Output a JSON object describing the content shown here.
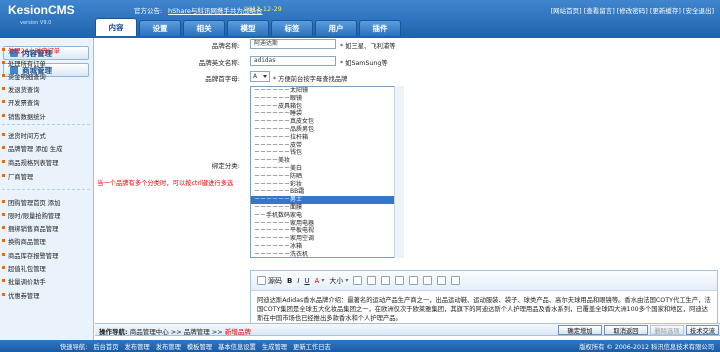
{
  "app": {
    "name": "KesionCMS",
    "version": "version V9.0"
  },
  "announce": {
    "label": "官方公告:",
    "item1": "hShare与科讯网携手共为战略合",
    "item2": "2011-12-29"
  },
  "toplinks": [
    "[网站首页]",
    "[查看留言]",
    "[修改密码]",
    "[更新缓存]",
    "[安全退出]"
  ],
  "tabs": [
    "内容",
    "设置",
    "相关",
    "模型",
    "标签",
    "用户",
    "插件"
  ],
  "sidebar": {
    "btn_content": "内容管理",
    "btn_mall": "商城管理",
    "items": [
      {
        "label": "处理24小时内订单",
        "red": true
      },
      {
        "label": "处理所有订单",
        "red": false
      },
      {
        "label": "资金明细查询",
        "red": false
      },
      {
        "label": "发退货查询",
        "red": false
      },
      {
        "label": "开发票查询",
        "red": false
      },
      {
        "label": "销售数据统计",
        "red": false
      },
      {
        "label": "送货时间方式",
        "red": false
      },
      {
        "label": "品牌管理 添加 生成",
        "red": false
      },
      {
        "label": "商品规格列表管理",
        "red": false
      },
      {
        "label": "厂商管理",
        "red": false
      },
      {
        "label": "团购管理首页 添加",
        "red": false
      },
      {
        "label": "限时/限量抢购管理",
        "red": false
      },
      {
        "label": "捆绑销售商品管理",
        "red": false
      },
      {
        "label": "换购商品管理",
        "red": false
      },
      {
        "label": "商品库存报警管理",
        "red": false
      },
      {
        "label": "超值礼包管理",
        "red": false
      },
      {
        "label": "批量调价助手",
        "red": false
      },
      {
        "label": "优惠券管理",
        "red": false
      }
    ]
  },
  "form": {
    "brand_name_label": "品牌名称:",
    "brand_name_value": "阿迪达斯",
    "brand_name_hint": "* 如三星、飞利浦等",
    "brand_en_label": "品牌英文名称:",
    "brand_en_value": "adidas",
    "brand_en_hint": "* 如SamSung等",
    "letter_label": "品牌首字母:",
    "letter_value": "A",
    "letter_hint": "* 方便前台按字母查找品牌",
    "category_label": "绑定分类:",
    "category_tip": "当一个品牌有多个分类时，可以按ctrl键进行多选",
    "categories": [
      {
        "text": "－－－－－－太阳镜",
        "selected": false
      },
      {
        "text": "－－－－－－眼镜",
        "selected": false
      },
      {
        "text": "－－－－皮具箱包",
        "selected": false
      },
      {
        "text": "－－－－－－睡袋",
        "selected": false
      },
      {
        "text": "－－－－－－真皮女包",
        "selected": false
      },
      {
        "text": "－－－－－－品质男包",
        "selected": false
      },
      {
        "text": "－－－－－－拉杆箱",
        "selected": false
      },
      {
        "text": "－－－－－－皮带",
        "selected": false
      },
      {
        "text": "－－－－－－钱包",
        "selected": false
      },
      {
        "text": "－－－－美妆",
        "selected": false
      },
      {
        "text": "－－－－－－美白",
        "selected": false
      },
      {
        "text": "－－－－－－防晒",
        "selected": false
      },
      {
        "text": "－－－－－－彩妆",
        "selected": false
      },
      {
        "text": "－－－－－－BB霜",
        "selected": false
      },
      {
        "text": "－－－－－－男士",
        "selected": true
      },
      {
        "text": "－－－－－－面膜",
        "selected": false
      },
      {
        "text": "－－手机数码家电",
        "selected": false
      },
      {
        "text": "－－－－－－家用电器",
        "selected": false
      },
      {
        "text": "－－－－－－平板电视",
        "selected": false
      },
      {
        "text": "－－－－－－家用空调",
        "selected": false
      },
      {
        "text": "－－－－－－冰箱",
        "selected": false
      },
      {
        "text": "－－－－－－洗衣机",
        "selected": false
      }
    ]
  },
  "editor": {
    "source_label": "源码",
    "font_size_label": "大小",
    "text": "阿迪达斯Adidas香水品牌介绍：最著名的运动产品生产商之一，出品运动鞋、运动服装、袋子、球类产品、高尔夫球用品和眼镜等。香水由法国COTY代工生产，法国COTY集团是全球五大化妆品集团之一，在欧洲仅次于欧莱雅集团，其旗下的阿迪达斯个人护理用品及香水系列，已覆盖全球四大洲100多个国家和地区，阿迪达斯在中国市场也已经推出多款香水和个人护理产品。"
  },
  "opnav": {
    "label": "操作导航:",
    "path1": "商品管理中心",
    "sep": ">>",
    "path2": "品牌管理",
    "current": "新增品牌"
  },
  "buttons": {
    "confirm": "确定增加",
    "cancel": "取消返回",
    "delete": "删除选项",
    "help": "技术交流"
  },
  "footer": {
    "links": [
      "快速导航:",
      "后台首页",
      "发布管理",
      "发布管理",
      "模板管理",
      "基本信息设置",
      "生成管理",
      "更新工作日志"
    ],
    "copy": "版权所有 © 2006-2012 科汛信息技术有限公司"
  }
}
